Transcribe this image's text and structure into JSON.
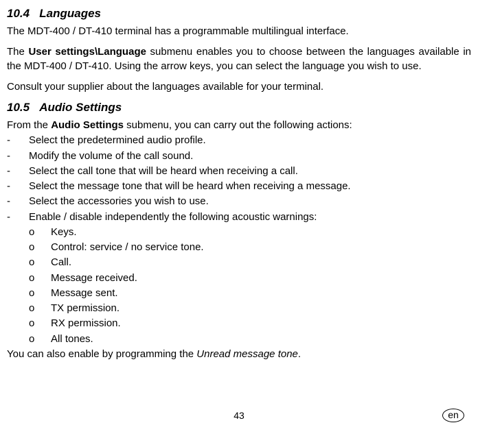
{
  "sections": {
    "languages": {
      "number": "10.4",
      "title": "Languages",
      "intro": "The MDT-400 / DT-410 terminal has a programmable multilingual interface.",
      "para2_pre": "The ",
      "para2_bold": "User settings\\Language",
      "para2_post": " submenu enables you to choose between the languages available in the MDT-400 / DT-410. Using the arrow keys, you can select the language you wish to use.",
      "para3": "Consult your supplier about the languages available for your terminal."
    },
    "audio": {
      "number": "10.5",
      "title": "Audio Settings",
      "intro_pre": "From the ",
      "intro_bold": "Audio Settings",
      "intro_post": " submenu, you can carry out the following actions:",
      "items": [
        "Select the predetermined audio profile.",
        "Modify the volume of the call sound.",
        "Select the call tone that will be heard when receiving a call.",
        "Select the message tone that will be heard when receiving a message.",
        "Select the accessories you wish to use.",
        "Enable / disable independently the following acoustic warnings:"
      ],
      "subitems": [
        "Keys.",
        "Control: service / no service tone.",
        "Call.",
        "Message received.",
        "Message sent.",
        "TX permission.",
        "RX permission.",
        "All tones."
      ],
      "outro_pre": "You can also enable by programming the ",
      "outro_italic": "Unread message tone",
      "outro_post": "."
    }
  },
  "markers": {
    "dash": "-",
    "circle": "o"
  },
  "footer": {
    "page": "43",
    "lang": "en"
  }
}
